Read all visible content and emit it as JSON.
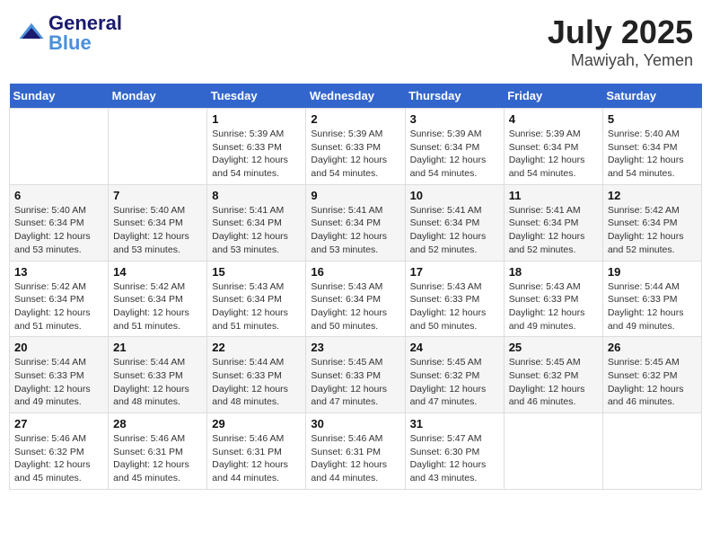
{
  "header": {
    "logo_text_general": "General",
    "logo_text_blue": "Blue",
    "month": "July 2025",
    "location": "Mawiyah, Yemen"
  },
  "days_of_week": [
    "Sunday",
    "Monday",
    "Tuesday",
    "Wednesday",
    "Thursday",
    "Friday",
    "Saturday"
  ],
  "weeks": [
    [
      {
        "day": "",
        "info": ""
      },
      {
        "day": "",
        "info": ""
      },
      {
        "day": "1",
        "sunrise": "Sunrise: 5:39 AM",
        "sunset": "Sunset: 6:33 PM",
        "daylight": "Daylight: 12 hours and 54 minutes."
      },
      {
        "day": "2",
        "sunrise": "Sunrise: 5:39 AM",
        "sunset": "Sunset: 6:33 PM",
        "daylight": "Daylight: 12 hours and 54 minutes."
      },
      {
        "day": "3",
        "sunrise": "Sunrise: 5:39 AM",
        "sunset": "Sunset: 6:34 PM",
        "daylight": "Daylight: 12 hours and 54 minutes."
      },
      {
        "day": "4",
        "sunrise": "Sunrise: 5:39 AM",
        "sunset": "Sunset: 6:34 PM",
        "daylight": "Daylight: 12 hours and 54 minutes."
      },
      {
        "day": "5",
        "sunrise": "Sunrise: 5:40 AM",
        "sunset": "Sunset: 6:34 PM",
        "daylight": "Daylight: 12 hours and 54 minutes."
      }
    ],
    [
      {
        "day": "6",
        "sunrise": "Sunrise: 5:40 AM",
        "sunset": "Sunset: 6:34 PM",
        "daylight": "Daylight: 12 hours and 53 minutes."
      },
      {
        "day": "7",
        "sunrise": "Sunrise: 5:40 AM",
        "sunset": "Sunset: 6:34 PM",
        "daylight": "Daylight: 12 hours and 53 minutes."
      },
      {
        "day": "8",
        "sunrise": "Sunrise: 5:41 AM",
        "sunset": "Sunset: 6:34 PM",
        "daylight": "Daylight: 12 hours and 53 minutes."
      },
      {
        "day": "9",
        "sunrise": "Sunrise: 5:41 AM",
        "sunset": "Sunset: 6:34 PM",
        "daylight": "Daylight: 12 hours and 53 minutes."
      },
      {
        "day": "10",
        "sunrise": "Sunrise: 5:41 AM",
        "sunset": "Sunset: 6:34 PM",
        "daylight": "Daylight: 12 hours and 52 minutes."
      },
      {
        "day": "11",
        "sunrise": "Sunrise: 5:41 AM",
        "sunset": "Sunset: 6:34 PM",
        "daylight": "Daylight: 12 hours and 52 minutes."
      },
      {
        "day": "12",
        "sunrise": "Sunrise: 5:42 AM",
        "sunset": "Sunset: 6:34 PM",
        "daylight": "Daylight: 12 hours and 52 minutes."
      }
    ],
    [
      {
        "day": "13",
        "sunrise": "Sunrise: 5:42 AM",
        "sunset": "Sunset: 6:34 PM",
        "daylight": "Daylight: 12 hours and 51 minutes."
      },
      {
        "day": "14",
        "sunrise": "Sunrise: 5:42 AM",
        "sunset": "Sunset: 6:34 PM",
        "daylight": "Daylight: 12 hours and 51 minutes."
      },
      {
        "day": "15",
        "sunrise": "Sunrise: 5:43 AM",
        "sunset": "Sunset: 6:34 PM",
        "daylight": "Daylight: 12 hours and 51 minutes."
      },
      {
        "day": "16",
        "sunrise": "Sunrise: 5:43 AM",
        "sunset": "Sunset: 6:34 PM",
        "daylight": "Daylight: 12 hours and 50 minutes."
      },
      {
        "day": "17",
        "sunrise": "Sunrise: 5:43 AM",
        "sunset": "Sunset: 6:33 PM",
        "daylight": "Daylight: 12 hours and 50 minutes."
      },
      {
        "day": "18",
        "sunrise": "Sunrise: 5:43 AM",
        "sunset": "Sunset: 6:33 PM",
        "daylight": "Daylight: 12 hours and 49 minutes."
      },
      {
        "day": "19",
        "sunrise": "Sunrise: 5:44 AM",
        "sunset": "Sunset: 6:33 PM",
        "daylight": "Daylight: 12 hours and 49 minutes."
      }
    ],
    [
      {
        "day": "20",
        "sunrise": "Sunrise: 5:44 AM",
        "sunset": "Sunset: 6:33 PM",
        "daylight": "Daylight: 12 hours and 49 minutes."
      },
      {
        "day": "21",
        "sunrise": "Sunrise: 5:44 AM",
        "sunset": "Sunset: 6:33 PM",
        "daylight": "Daylight: 12 hours and 48 minutes."
      },
      {
        "day": "22",
        "sunrise": "Sunrise: 5:44 AM",
        "sunset": "Sunset: 6:33 PM",
        "daylight": "Daylight: 12 hours and 48 minutes."
      },
      {
        "day": "23",
        "sunrise": "Sunrise: 5:45 AM",
        "sunset": "Sunset: 6:33 PM",
        "daylight": "Daylight: 12 hours and 47 minutes."
      },
      {
        "day": "24",
        "sunrise": "Sunrise: 5:45 AM",
        "sunset": "Sunset: 6:32 PM",
        "daylight": "Daylight: 12 hours and 47 minutes."
      },
      {
        "day": "25",
        "sunrise": "Sunrise: 5:45 AM",
        "sunset": "Sunset: 6:32 PM",
        "daylight": "Daylight: 12 hours and 46 minutes."
      },
      {
        "day": "26",
        "sunrise": "Sunrise: 5:45 AM",
        "sunset": "Sunset: 6:32 PM",
        "daylight": "Daylight: 12 hours and 46 minutes."
      }
    ],
    [
      {
        "day": "27",
        "sunrise": "Sunrise: 5:46 AM",
        "sunset": "Sunset: 6:32 PM",
        "daylight": "Daylight: 12 hours and 45 minutes."
      },
      {
        "day": "28",
        "sunrise": "Sunrise: 5:46 AM",
        "sunset": "Sunset: 6:31 PM",
        "daylight": "Daylight: 12 hours and 45 minutes."
      },
      {
        "day": "29",
        "sunrise": "Sunrise: 5:46 AM",
        "sunset": "Sunset: 6:31 PM",
        "daylight": "Daylight: 12 hours and 44 minutes."
      },
      {
        "day": "30",
        "sunrise": "Sunrise: 5:46 AM",
        "sunset": "Sunset: 6:31 PM",
        "daylight": "Daylight: 12 hours and 44 minutes."
      },
      {
        "day": "31",
        "sunrise": "Sunrise: 5:47 AM",
        "sunset": "Sunset: 6:30 PM",
        "daylight": "Daylight: 12 hours and 43 minutes."
      },
      {
        "day": "",
        "info": ""
      },
      {
        "day": "",
        "info": ""
      }
    ]
  ]
}
